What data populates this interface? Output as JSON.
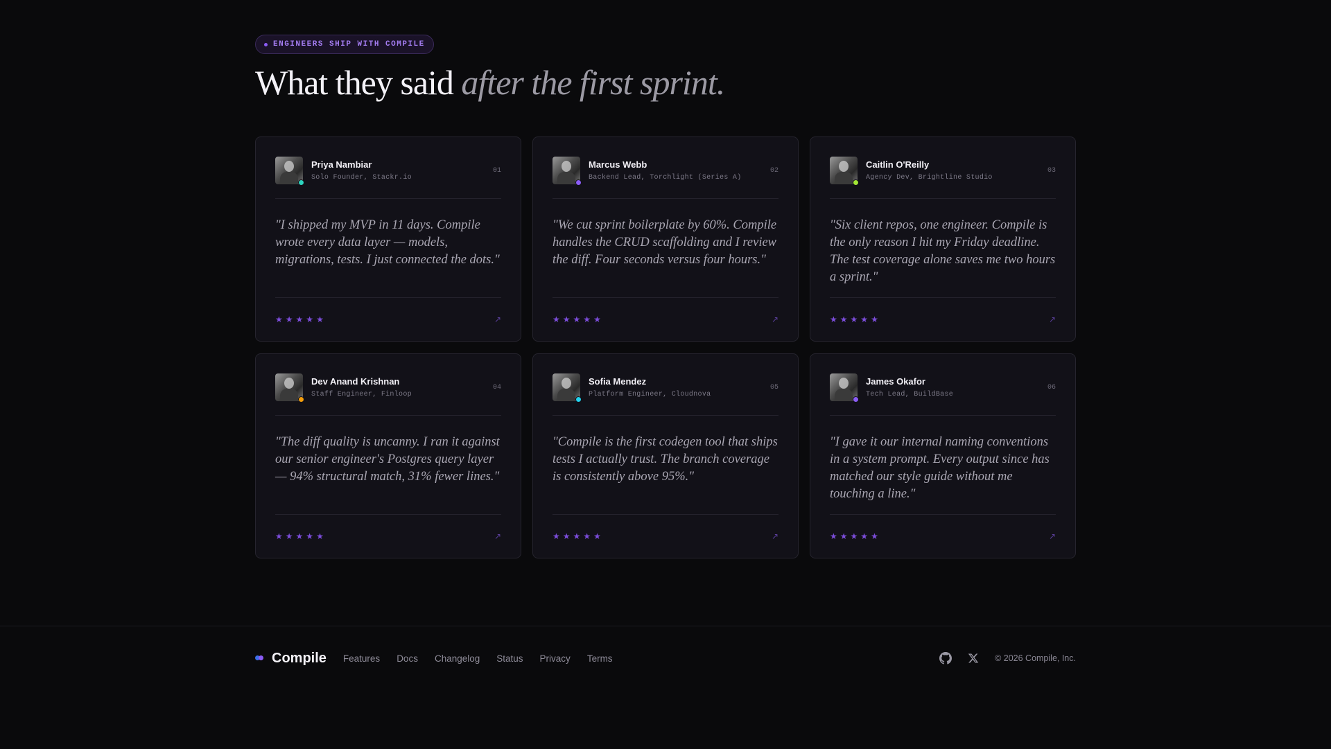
{
  "header": {
    "eyebrow": "ENGINEERS SHIP WITH COMPILE",
    "headline_main": "What they said",
    "headline_accent": "after the first sprint."
  },
  "testimonials": [
    {
      "name": "Priya Nambiar",
      "role": "Solo Founder, Stackr.io",
      "number": "01",
      "quote": "\"I shipped my MVP in 11 days. Compile wrote every data layer — models, migrations, tests. I just connected the dots.\"",
      "rating": 5,
      "status_color": "#2dd4bf"
    },
    {
      "name": "Marcus Webb",
      "role": "Backend Lead, Torchlight (Series A)",
      "number": "02",
      "quote": "\"We cut sprint boilerplate by 60%. Compile handles the CRUD scaffolding and I review the diff. Four seconds versus four hours.\"",
      "rating": 5,
      "status_color": "#8b5cf6"
    },
    {
      "name": "Caitlin O'Reilly",
      "role": "Agency Dev, Brightline Studio",
      "number": "03",
      "quote": "\"Six client repos, one engineer. Compile is the only reason I hit my Friday deadline. The test coverage alone saves me two hours a sprint.\"",
      "rating": 5,
      "status_color": "#a3e635"
    },
    {
      "name": "Dev Anand Krishnan",
      "role": "Staff Engineer, Finloop",
      "number": "04",
      "quote": "\"The diff quality is uncanny. I ran it against our senior engineer's Postgres query layer — 94% structural match, 31% fewer lines.\"",
      "rating": 5,
      "status_color": "#f59e0b"
    },
    {
      "name": "Sofia Mendez",
      "role": "Platform Engineer, Cloudnova",
      "number": "05",
      "quote": "\"Compile is the first codegen tool that ships tests I actually trust. The branch coverage is consistently above 95%.\"",
      "rating": 5,
      "status_color": "#22d3ee"
    },
    {
      "name": "James Okafor",
      "role": "Tech Lead, BuildBase",
      "number": "06",
      "quote": "\"I gave it our internal naming conventions in a system prompt. Every output since has matched our style guide without me touching a line.\"",
      "rating": 5,
      "status_color": "#8b5cf6"
    }
  ],
  "footer": {
    "brand": "Compile",
    "nav": [
      "Features",
      "Docs",
      "Changelog",
      "Status",
      "Privacy",
      "Terms"
    ],
    "social_icons": [
      "github-icon",
      "x-icon"
    ],
    "copyright": "© 2026 Compile, Inc."
  },
  "colors": {
    "background": "#0a0a0c",
    "card": "#121118",
    "accent": "#7c4ddb"
  }
}
